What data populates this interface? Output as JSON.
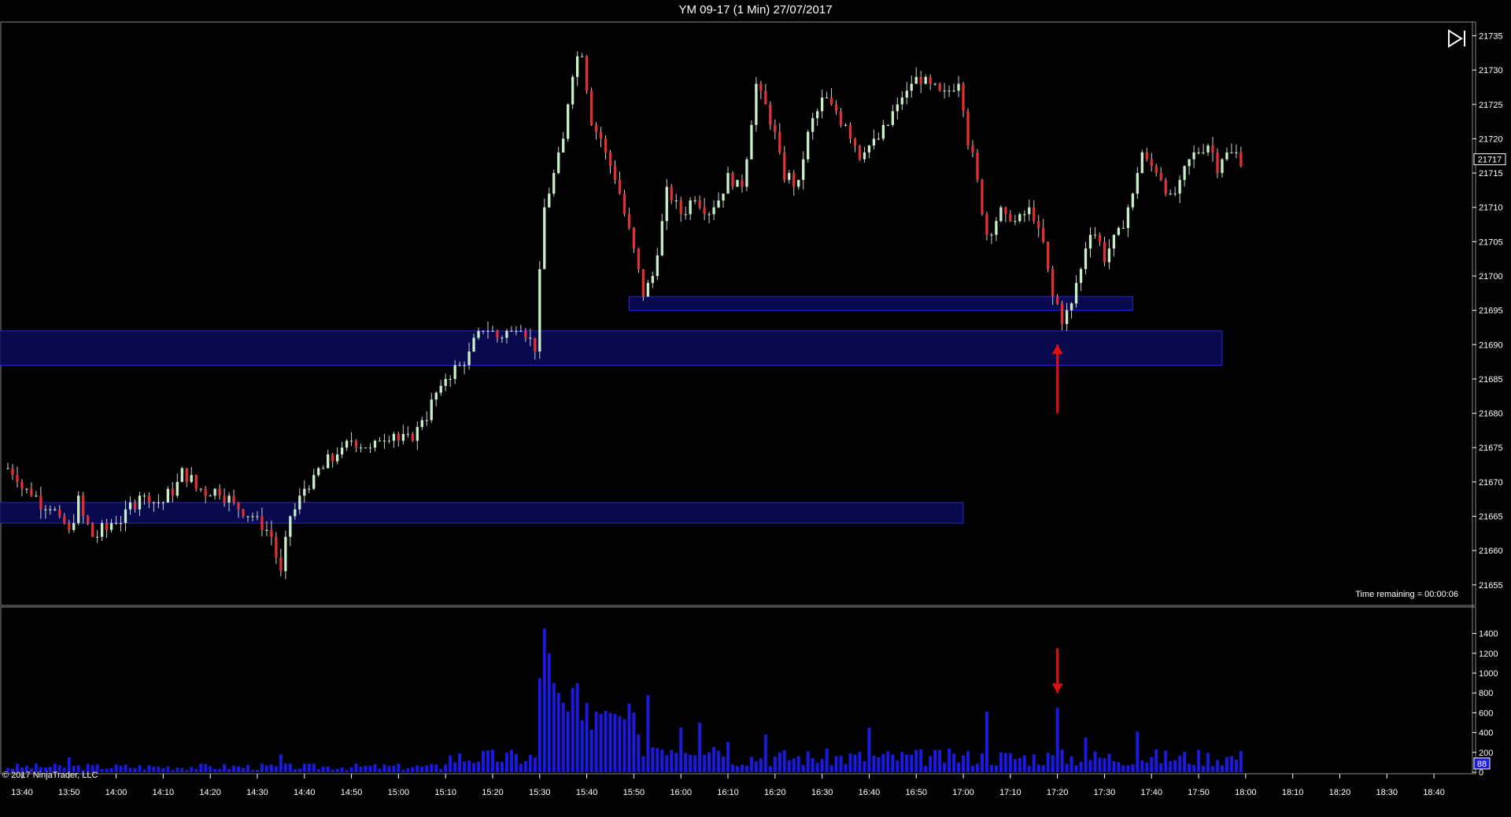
{
  "window": {
    "title": "YM 09-17 (1 Min)  27/07/2017"
  },
  "status": {
    "time_remaining": "Time remaining = 00:00:06",
    "copyright": "© 2017 NinjaTrader, LLC"
  },
  "icons": {
    "skip_end": "skip-to-end-icon"
  },
  "colors": {
    "background": "#000000",
    "up_candle": "#c8f0c8",
    "down_candle": "#e03030",
    "zone_fill": "#0a0a5a",
    "zone_border": "#2828d0",
    "volume": "#1a1ae6",
    "arrow": "#e01010"
  },
  "chart_data": [
    {
      "type": "candlestick",
      "title": "YM 09-17 (1 Min)  27/07/2017",
      "x_ticks": [
        "13:40",
        "13:50",
        "14:00",
        "14:10",
        "14:20",
        "14:30",
        "14:40",
        "14:50",
        "15:00",
        "15:10",
        "15:20",
        "15:30",
        "15:40",
        "15:50",
        "16:00",
        "16:10",
        "16:20",
        "16:30",
        "16:40",
        "16:50",
        "17:00",
        "17:10",
        "17:20",
        "17:30",
        "17:40",
        "17:50",
        "18:00",
        "18:10",
        "18:20",
        "18:30",
        "18:40"
      ],
      "y_ticks": [
        21655,
        21660,
        21665,
        21670,
        21675,
        21680,
        21685,
        21690,
        21695,
        21700,
        21705,
        21710,
        21715,
        21720,
        21725,
        21730,
        21735
      ],
      "ylim": [
        21652,
        21737
      ],
      "last_price": 21717,
      "price_path": [
        [
          "13:37",
          21672
        ],
        [
          "13:42",
          21668
        ],
        [
          "13:46",
          21666
        ],
        [
          "13:50",
          21663
        ],
        [
          "13:52",
          21667
        ],
        [
          "13:55",
          21662
        ],
        [
          "14:00",
          21664
        ],
        [
          "14:05",
          21668
        ],
        [
          "14:10",
          21667
        ],
        [
          "14:14",
          21671
        ],
        [
          "14:18",
          21669
        ],
        [
          "14:23",
          21668
        ],
        [
          "14:27",
          21666
        ],
        [
          "14:30",
          21664
        ],
        [
          "14:33",
          21662
        ],
        [
          "14:35",
          21657
        ],
        [
          "14:37",
          21665
        ],
        [
          "14:40",
          21669
        ],
        [
          "14:45",
          21673
        ],
        [
          "14:50",
          21676
        ],
        [
          "14:54",
          21675
        ],
        [
          "14:58",
          21677
        ],
        [
          "15:02",
          21676
        ],
        [
          "15:06",
          21680
        ],
        [
          "15:10",
          21685
        ],
        [
          "15:14",
          21688
        ],
        [
          "15:18",
          21692
        ],
        [
          "15:22",
          21691
        ],
        [
          "15:26",
          21693
        ],
        [
          "15:29",
          21690
        ],
        [
          "15:31",
          21710
        ],
        [
          "15:33",
          21715
        ],
        [
          "15:35",
          21720
        ],
        [
          "15:37",
          21730
        ],
        [
          "15:39",
          21733
        ],
        [
          "15:41",
          21723
        ],
        [
          "15:44",
          21718
        ],
        [
          "15:47",
          21712
        ],
        [
          "15:50",
          21704
        ],
        [
          "15:52",
          21697
        ],
        [
          "15:54",
          21700
        ],
        [
          "15:57",
          21712
        ],
        [
          "16:00",
          21709
        ],
        [
          "16:03",
          21712
        ],
        [
          "16:06",
          21709
        ],
        [
          "16:10",
          21714
        ],
        [
          "16:13",
          21713
        ],
        [
          "16:16",
          21728
        ],
        [
          "16:19",
          21723
        ],
        [
          "16:22",
          21715
        ],
        [
          "16:25",
          21713
        ],
        [
          "16:27",
          21721
        ],
        [
          "16:30",
          21726
        ],
        [
          "16:33",
          21724
        ],
        [
          "16:35",
          21722
        ],
        [
          "16:38",
          21718
        ],
        [
          "16:41",
          21719
        ],
        [
          "16:44",
          21722
        ],
        [
          "16:47",
          21726
        ],
        [
          "16:50",
          21729
        ],
        [
          "16:53",
          21728
        ],
        [
          "16:56",
          21726
        ],
        [
          "16:59",
          21729
        ],
        [
          "17:01",
          21720
        ],
        [
          "17:03",
          21714
        ],
        [
          "17:05",
          21706
        ],
        [
          "17:08",
          21709
        ],
        [
          "17:11",
          21708
        ],
        [
          "17:14",
          21710
        ],
        [
          "17:17",
          21705
        ],
        [
          "17:19",
          21697
        ],
        [
          "17:21",
          21694
        ],
        [
          "17:23",
          21696
        ],
        [
          "17:25",
          21701
        ],
        [
          "17:27",
          21707
        ],
        [
          "17:30",
          21703
        ],
        [
          "17:33",
          21706
        ],
        [
          "17:36",
          21712
        ],
        [
          "17:38",
          21718
        ],
        [
          "17:40",
          21716
        ],
        [
          "17:42",
          21714
        ],
        [
          "17:44",
          21711
        ],
        [
          "17:47",
          21715
        ],
        [
          "17:49",
          21718
        ],
        [
          "17:52",
          21719
        ],
        [
          "17:54",
          21716
        ],
        [
          "17:56",
          21718
        ],
        [
          "17:59",
          21717
        ]
      ],
      "annotation_zones": [
        {
          "from": "13:32",
          "to": "17:55",
          "low": 21687,
          "high": 21692
        },
        {
          "from": "15:49",
          "to": "17:36",
          "low": 21695,
          "high": 21697
        },
        {
          "from": "13:32",
          "to": "17:00",
          "low": 21664,
          "high": 21667
        }
      ],
      "annotation_arrows": [
        {
          "time": "17:20",
          "from_price": 21680,
          "to_price": 21690,
          "direction": "up"
        }
      ]
    },
    {
      "type": "bar",
      "series": "Volume",
      "y_ticks": [
        0,
        200,
        400,
        600,
        800,
        1000,
        1200,
        1400
      ],
      "ylim": [
        0,
        1500
      ],
      "last_value": 88,
      "spikes": [
        [
          "13:50",
          150
        ],
        [
          "14:35",
          180
        ],
        [
          "15:30",
          950
        ],
        [
          "15:31",
          1450
        ],
        [
          "15:32",
          1200
        ],
        [
          "15:33",
          900
        ],
        [
          "15:34",
          800
        ],
        [
          "15:35",
          700
        ],
        [
          "15:37",
          850
        ],
        [
          "15:38",
          900
        ],
        [
          "15:40",
          700
        ],
        [
          "15:45",
          600
        ],
        [
          "15:53",
          780
        ],
        [
          "16:00",
          450
        ],
        [
          "16:04",
          500
        ],
        [
          "16:18",
          380
        ],
        [
          "16:40",
          450
        ],
        [
          "17:05",
          610
        ],
        [
          "17:20",
          650
        ],
        [
          "17:26",
          350
        ],
        [
          "17:37",
          410
        ]
      ],
      "annotation_arrows": [
        {
          "time": "17:20",
          "from_value": 1250,
          "to_value": 800,
          "direction": "down"
        }
      ]
    }
  ]
}
